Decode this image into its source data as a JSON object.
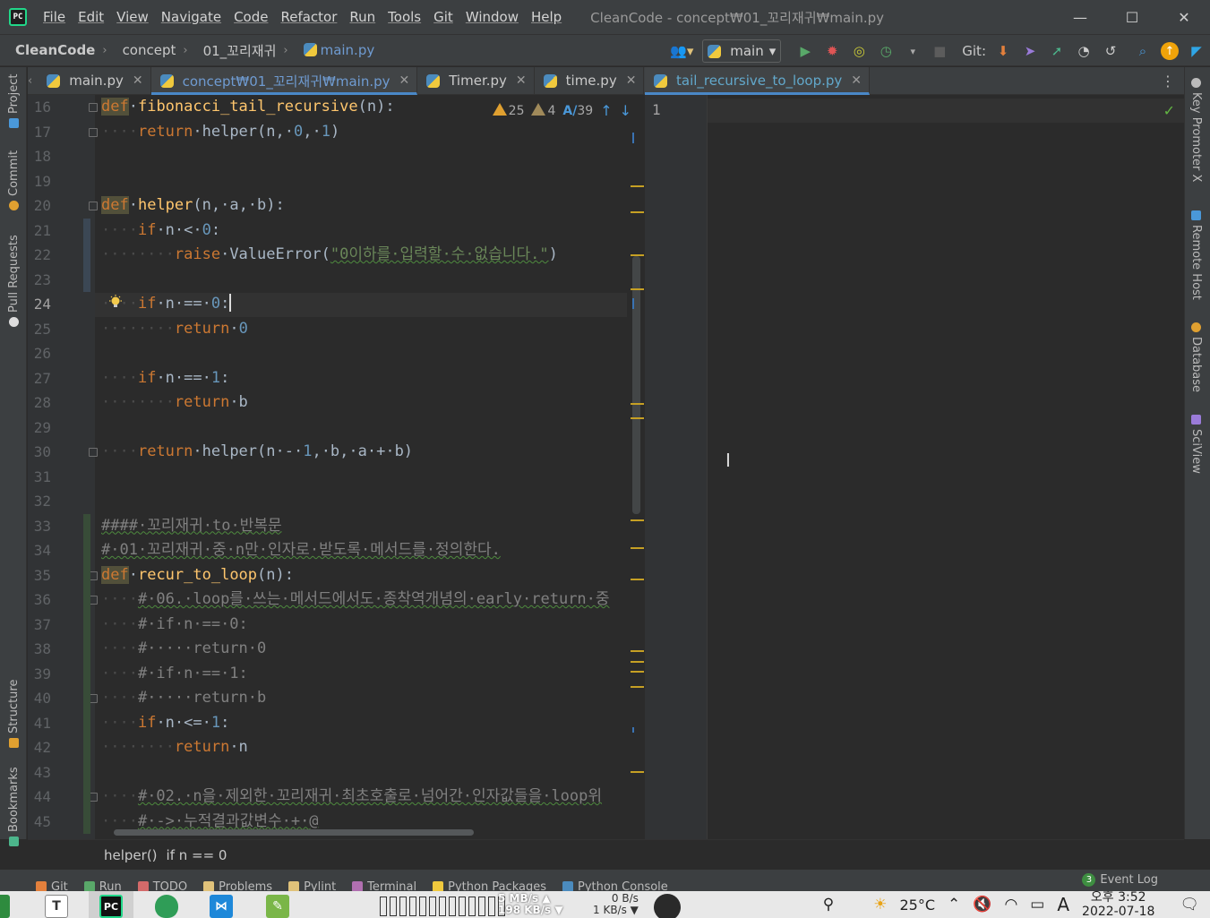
{
  "window": {
    "title": "CleanCode - concept₩01_꼬리재귀₩main.py",
    "logo_text": "PC",
    "minimize": "—",
    "maximize": "☐",
    "close": "✕"
  },
  "menu": [
    "File",
    "Edit",
    "View",
    "Navigate",
    "Code",
    "Refactor",
    "Run",
    "Tools",
    "Git",
    "Window",
    "Help"
  ],
  "breadcrumb": {
    "project": "CleanCode",
    "folder1": "concept",
    "folder2": "01_꼬리재귀",
    "file": "main.py",
    "separator": "›"
  },
  "toolbar": {
    "branch": "main",
    "git_label": "Git:"
  },
  "left_strip": [
    "Project",
    "Commit",
    "Pull Requests",
    "Structure",
    "Bookmarks"
  ],
  "right_strip": [
    "Key Promoter X",
    "Remote Host",
    "Database",
    "SciView"
  ],
  "tabs_left": [
    {
      "label": "main.py",
      "active": false
    },
    {
      "label": "concept₩01_꼬리재귀₩main.py",
      "active": true
    },
    {
      "label": "Timer.py",
      "active": false
    },
    {
      "label": "time.py",
      "active": false
    }
  ],
  "tabs_right": [
    {
      "label": "tail_recursive_to_loop.py",
      "active": true
    }
  ],
  "inspections": {
    "warnings": "25",
    "weak_warnings": "4",
    "typos": "39"
  },
  "editor_left": {
    "current_line": "24",
    "lines": [
      {
        "no": "16",
        "tokens": [
          [
            "kw-hl",
            "def"
          ],
          [
            "",
            "·"
          ],
          [
            "fn",
            "fibonacci_tail_recursive"
          ],
          [
            "",
            "(n):"
          ]
        ]
      },
      {
        "no": "17",
        "tokens": [
          [
            "ws",
            "····"
          ],
          [
            "kw",
            "return"
          ],
          [
            "",
            "·helper(n,·"
          ],
          [
            "num",
            "0"
          ],
          [
            "",
            ",·"
          ],
          [
            "num",
            "1"
          ],
          [
            "",
            ")"
          ]
        ]
      },
      {
        "no": "18",
        "tokens": []
      },
      {
        "no": "19",
        "tokens": []
      },
      {
        "no": "20",
        "tokens": [
          [
            "kw-hl",
            "def"
          ],
          [
            "",
            "·"
          ],
          [
            "fn",
            "helper"
          ],
          [
            "",
            "(n,·a,·b):"
          ]
        ]
      },
      {
        "no": "21",
        "tokens": [
          [
            "ws",
            "····"
          ],
          [
            "kw",
            "if"
          ],
          [
            "",
            "·n·<·"
          ],
          [
            "num",
            "0"
          ],
          [
            "",
            ":"
          ]
        ]
      },
      {
        "no": "22",
        "tokens": [
          [
            "ws",
            "········"
          ],
          [
            "kw",
            "raise"
          ],
          [
            "",
            "·ValueError("
          ],
          [
            "str",
            "\"0이하를·입력할·수·없습니다.\""
          ],
          [
            "",
            ")"
          ]
        ]
      },
      {
        "no": "23",
        "tokens": []
      },
      {
        "no": "24",
        "tokens": [
          [
            "ws",
            "····"
          ],
          [
            "kw",
            "if"
          ],
          [
            "",
            "·n·==·"
          ],
          [
            "num",
            "0"
          ],
          [
            "",
            ":"
          ]
        ]
      },
      {
        "no": "25",
        "tokens": [
          [
            "ws",
            "········"
          ],
          [
            "kw",
            "return"
          ],
          [
            "",
            "·"
          ],
          [
            "num",
            "0"
          ]
        ]
      },
      {
        "no": "26",
        "tokens": []
      },
      {
        "no": "27",
        "tokens": [
          [
            "ws",
            "····"
          ],
          [
            "kw",
            "if"
          ],
          [
            "",
            "·n·==·"
          ],
          [
            "num",
            "1"
          ],
          [
            "",
            ":"
          ]
        ]
      },
      {
        "no": "28",
        "tokens": [
          [
            "ws",
            "········"
          ],
          [
            "kw",
            "return"
          ],
          [
            "",
            "·b"
          ]
        ]
      },
      {
        "no": "29",
        "tokens": []
      },
      {
        "no": "30",
        "tokens": [
          [
            "ws",
            "····"
          ],
          [
            "kw",
            "return"
          ],
          [
            "",
            "·helper(n·-·"
          ],
          [
            "num",
            "1"
          ],
          [
            "",
            ",·b,·a·+·b)"
          ]
        ]
      },
      {
        "no": "31",
        "tokens": []
      },
      {
        "no": "32",
        "tokens": []
      },
      {
        "no": "33",
        "tokens": [
          [
            "cmt",
            "####·꼬리재귀·to·반복문"
          ]
        ]
      },
      {
        "no": "34",
        "tokens": [
          [
            "cmt",
            "#·01·꼬리재귀·중·n만·인자로·받도록·메서드를·정의한다."
          ]
        ]
      },
      {
        "no": "35",
        "tokens": [
          [
            "kw-hl",
            "def"
          ],
          [
            "",
            "·"
          ],
          [
            "fn",
            "recur_to_loop"
          ],
          [
            "",
            "(n):"
          ]
        ]
      },
      {
        "no": "36",
        "tokens": [
          [
            "ws",
            "····"
          ],
          [
            "cmt",
            "#·06.·loop를·쓰는·메서드에서도·종착역개념의·early·return·중"
          ]
        ]
      },
      {
        "no": "37",
        "tokens": [
          [
            "ws",
            "····"
          ],
          [
            "cmt",
            "#·if·n·==·0:"
          ]
        ]
      },
      {
        "no": "38",
        "tokens": [
          [
            "ws",
            "····"
          ],
          [
            "cmt",
            "#·····return·0"
          ]
        ]
      },
      {
        "no": "39",
        "tokens": [
          [
            "ws",
            "····"
          ],
          [
            "cmt",
            "#·if·n·==·1:"
          ]
        ]
      },
      {
        "no": "40",
        "tokens": [
          [
            "ws",
            "····"
          ],
          [
            "cmt",
            "#·····return·b"
          ]
        ]
      },
      {
        "no": "41",
        "tokens": [
          [
            "ws",
            "····"
          ],
          [
            "kw",
            "if"
          ],
          [
            "",
            "·n·<=·"
          ],
          [
            "num",
            "1"
          ],
          [
            "",
            ":"
          ]
        ]
      },
      {
        "no": "42",
        "tokens": [
          [
            "ws",
            "········"
          ],
          [
            "kw",
            "return"
          ],
          [
            "",
            "·n"
          ]
        ]
      },
      {
        "no": "43",
        "tokens": []
      },
      {
        "no": "44",
        "tokens": [
          [
            "ws",
            "····"
          ],
          [
            "cmt",
            "#·02.·n을·제외한·꼬리재귀·최초호출로·넘어간·인자값들을·loop위"
          ]
        ]
      },
      {
        "no": "45",
        "tokens": [
          [
            "ws",
            "····"
          ],
          [
            "cmt",
            "#·->·누적결과값변수·+·@"
          ]
        ]
      }
    ]
  },
  "editor_right": {
    "line_no": "1"
  },
  "code_breadcrumb": {
    "scope": "helper()",
    "stmt": "if n == 0"
  },
  "tool_windows": [
    "Git",
    "Run",
    "TODO",
    "Problems",
    "Pylint",
    "Terminal",
    "Python Packages",
    "Python Console"
  ],
  "event_log": {
    "count": "3",
    "label": "Event Log"
  },
  "taskbar": {
    "net_up": "5 MB/s ▲",
    "net_down": "198 KB/s ▼",
    "disk_up": "0 B/s",
    "disk_down": "1 KB/s ▼",
    "temperature": "25°C",
    "ime": "A",
    "time": "오후 3:52",
    "date": "2022-07-18"
  }
}
